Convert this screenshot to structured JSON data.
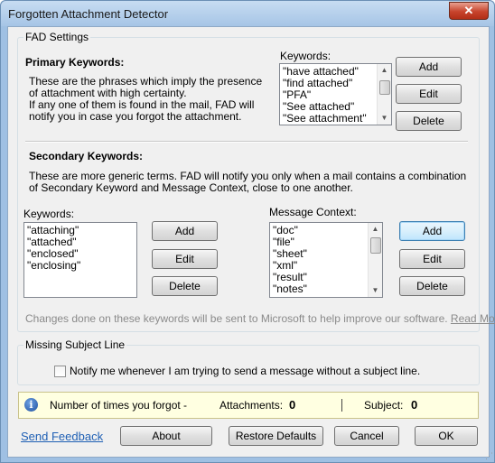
{
  "window": {
    "title": "Forgotten Attachment Detector",
    "close_glyph": "✕"
  },
  "fad_settings": {
    "legend": "FAD Settings",
    "primary": {
      "heading": "Primary Keywords:",
      "desc_lines": [
        "These are the phrases which imply the presence",
        "of attachment with high certainty.",
        "If any one of them is found in the mail, FAD will",
        "notify you in case you forgot the attachment."
      ],
      "list_label": "Keywords:",
      "keywords": [
        "\"have attached\"",
        "\"find attached\"",
        "\"PFA\"",
        "\"See attached\"",
        "\"See attachment\""
      ],
      "add_label": "Add",
      "edit_label": "Edit",
      "delete_label": "Delete"
    },
    "secondary": {
      "heading": "Secondary Keywords:",
      "desc_lines": [
        "These are more generic terms. FAD will notify you only when a mail contains a combination",
        "of Secondary Keyword and Message Context, close to one another."
      ],
      "keywords_label": "Keywords:",
      "keywords": [
        "\"attaching\"",
        "\"attached\"",
        "\"enclosed\"",
        "\"enclosing\""
      ],
      "context_label": "Message Context:",
      "contexts": [
        "\"doc\"",
        "\"file\"",
        "\"sheet\"",
        "\"xml\"",
        "\"result\"",
        "\"notes\""
      ],
      "add_label": "Add",
      "edit_label": "Edit",
      "delete_label": "Delete"
    },
    "footer_note": "Changes done on these keywords will be sent to Microsoft to help improve our software.",
    "read_more": "Read More"
  },
  "missing_subject": {
    "legend": "Missing Subject Line",
    "checkbox_label": "Notify me whenever I am trying to send a message without a subject line.",
    "checked": false
  },
  "stats": {
    "label": "Number of times you forgot -",
    "attachments_label": "Attachments:",
    "attachments_count": "0",
    "subject_label": "Subject:",
    "subject_count": "0"
  },
  "footer": {
    "send_feedback": "Send Feedback",
    "about": "About",
    "restore_defaults": "Restore Defaults",
    "cancel": "Cancel",
    "ok": "OK"
  },
  "icons": {
    "info": "info-icon",
    "close": "close-icon"
  }
}
